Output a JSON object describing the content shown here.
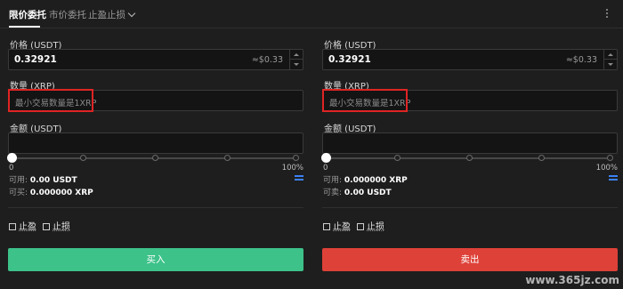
{
  "tabs": [
    {
      "label": "限价委托"
    },
    {
      "label": "市价委托"
    },
    {
      "label": "止盈止损"
    }
  ],
  "icons": {
    "dropdown": "chevron-down-icon",
    "more": "vertical-dots-icon",
    "swap": "swap-arrows-icon",
    "checkbox": "checkbox-icon"
  },
  "buy_panel": {
    "price_label": "价格 (USDT)",
    "price_value": "0.32921",
    "price_approx": "≈$0.33",
    "qty_label": "数量 (XRP)",
    "qty_placeholder": "最小交易数量是1XRP",
    "amount_label": "金额 (USDT)",
    "slider_min": "0",
    "slider_max": "100%",
    "slider_value": 0,
    "available_label": "可用:",
    "available_value": "0.00 USDT",
    "can_trade_label": "可买:",
    "can_trade_value": "0.000000 XRP",
    "take_profit": "止盈",
    "stop_loss": "止损",
    "action_label": "买入"
  },
  "sell_panel": {
    "price_label": "价格 (USDT)",
    "price_value": "0.32921",
    "price_approx": "≈$0.33",
    "qty_label": "数量 (XRP)",
    "qty_placeholder": "最小交易数量是1XRP",
    "amount_label": "金额 (USDT)",
    "slider_min": "0",
    "slider_max": "100%",
    "slider_value": 0,
    "available_label": "可用:",
    "available_value": "0.000000 XRP",
    "can_trade_label": "可卖:",
    "can_trade_value": "0.00 USDT",
    "take_profit": "止盈",
    "stop_loss": "止损",
    "action_label": "卖出"
  },
  "colors": {
    "background": "#1e1e1e",
    "input_bg": "#141414",
    "buy": "#3dc28a",
    "sell": "#de4138",
    "highlight": "#e02424",
    "accent_blue": "#3b82f6"
  },
  "watermark": "www.365jz.com"
}
